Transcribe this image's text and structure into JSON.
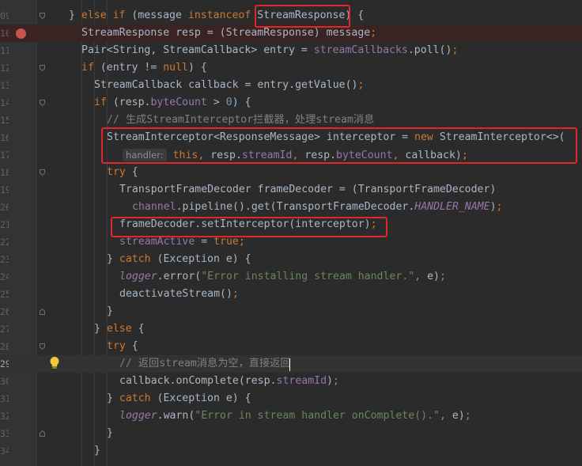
{
  "line_numbers": [
    "09",
    "10",
    "11",
    "12",
    "13",
    "14",
    "15",
    "16",
    "17",
    "18",
    "19",
    "20",
    "21",
    "22",
    "23",
    "24",
    "25",
    "26",
    "27",
    "28",
    "29",
    "30",
    "31",
    "32",
    "33",
    "34"
  ],
  "current_line_number": "29",
  "inlay_hint": "handler:",
  "lines": {
    "l0": {
      "p1": "} ",
      "kw1": "else if",
      "p2": " (message ",
      "kw2": "instanceof",
      "p3": " StreamResponse) {"
    },
    "l1": {
      "p1": "StreamResponse resp = (StreamResponse) message",
      "semi": ";"
    },
    "l2": {
      "p1": "Pair<String, StreamCallback> entry = ",
      "f1": "streamCallbacks",
      "p2": ".poll()",
      "semi": ";"
    },
    "l3": {
      "kw1": "if",
      "p1": " (entry != ",
      "kw2": "null",
      "p2": ") {"
    },
    "l4": {
      "p1": "StreamCallback callback = entry.getValue()",
      "semi": ";"
    },
    "l5": {
      "kw1": "if",
      "p1": " (resp.",
      "f1": "byteCount",
      "p2": " > ",
      "n1": "0",
      "p3": ") {"
    },
    "l6": {
      "c1": "// 生成StreamInterceptor拦截器，处理stream消息"
    },
    "l7": {
      "p1": "StreamInterceptor<ResponseMessage> interceptor = ",
      "kw1": "new",
      "p2": " StreamInterceptor<>("
    },
    "l8": {
      "kw1": "this",
      "comma1": ", ",
      "p1": "resp.",
      "f1": "streamId",
      "comma2": ", ",
      "p2": "resp.",
      "f2": "byteCount",
      "comma3": ", ",
      "p3": "callback)",
      "semi": ";"
    },
    "l9": {
      "kw1": "try",
      "p1": " {"
    },
    "l10": {
      "p1": "TransportFrameDecoder frameDecoder = (TransportFrameDecoder)"
    },
    "l11": {
      "f1": "channel",
      "p1": ".pipeline().get(TransportFrameDecoder.",
      "f2": "HANDLER_NAME",
      "p2": ")",
      "semi": ";"
    },
    "l12": {
      "p1": "frameDecoder.setInterceptor(interceptor)",
      "semi": ";"
    },
    "l13": {
      "f1": "streamActive",
      "p1": " = ",
      "kw1": "true",
      "semi": ";"
    },
    "l14": {
      "p1": "} ",
      "kw1": "catch",
      "p2": " (Exception e) {"
    },
    "l15": {
      "f1": "logger",
      "p1": ".error(",
      "s1": "\"Error installing stream handler.\"",
      "comma1": ", ",
      "p2": "e)",
      "semi": ";"
    },
    "l16": {
      "p1": "deactivateStream()",
      "semi": ";"
    },
    "l17": {
      "p1": "}"
    },
    "l18": {
      "p1": "} ",
      "kw1": "else",
      "p2": " {"
    },
    "l19": {
      "kw1": "try",
      "p1": " {"
    },
    "l20": {
      "c1": "// 返回stream消息为空，直接返回"
    },
    "l21": {
      "p1": "callback.onComplete(resp.",
      "f1": "streamId",
      "p2": ")",
      "semi": ";"
    },
    "l22": {
      "p1": "} ",
      "kw1": "catch",
      "p2": " (Exception e) {"
    },
    "l23": {
      "f1": "logger",
      "p1": ".warn(",
      "s1": "\"Error in stream handler onComplete().\"",
      "comma1": ", ",
      "p2": "e)",
      "semi": ";"
    },
    "l24": {
      "p1": "}"
    },
    "l25": {
      "p1": "}"
    }
  }
}
